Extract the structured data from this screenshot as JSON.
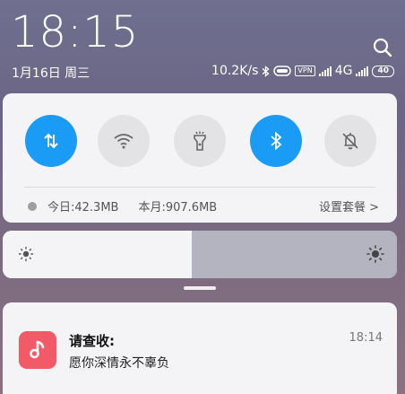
{
  "status": {
    "time": "18:15",
    "date": "1月16日 周三",
    "network_speed": "10.2K/s",
    "vpn_badge": "VPN",
    "network_type": "4G",
    "battery": "40"
  },
  "quick_toggles": [
    {
      "name": "mobile-data",
      "icon": "data-transfer-icon",
      "active": true
    },
    {
      "name": "wifi",
      "icon": "wifi-icon",
      "active": false
    },
    {
      "name": "flashlight",
      "icon": "flashlight-icon",
      "active": false
    },
    {
      "name": "bluetooth",
      "icon": "bluetooth-icon",
      "active": true
    },
    {
      "name": "mute",
      "icon": "bell-off-icon",
      "active": false
    }
  ],
  "data_usage": {
    "today": "今日:42.3MB",
    "month": "本月:907.6MB",
    "plan_link": "设置套餐 >"
  },
  "brightness": {
    "level": 0.48
  },
  "notification": {
    "title": "请查收:",
    "body": "愿你深情永不辜负",
    "time": "18:14"
  },
  "colors": {
    "accent": "#1a9bf6",
    "app_icon": "#f25a68"
  }
}
